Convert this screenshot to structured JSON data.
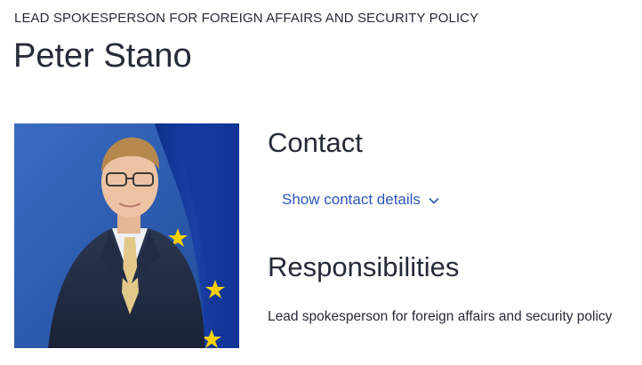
{
  "header": {
    "role": "LEAD SPOKESPERSON FOR FOREIGN AFFAIRS AND SECURITY POLICY",
    "name": "Peter Stano"
  },
  "photo": {
    "subject": "portrait-photo",
    "background_color": "#2d5fb0"
  },
  "contact": {
    "heading": "Contact",
    "toggle_label": "Show contact details",
    "toggle_icon": "chevron-down-icon",
    "link_color": "#2b55b8"
  },
  "responsibilities": {
    "heading": "Responsibilities",
    "text": "Lead spokesperson for foreign affairs and security policy"
  }
}
